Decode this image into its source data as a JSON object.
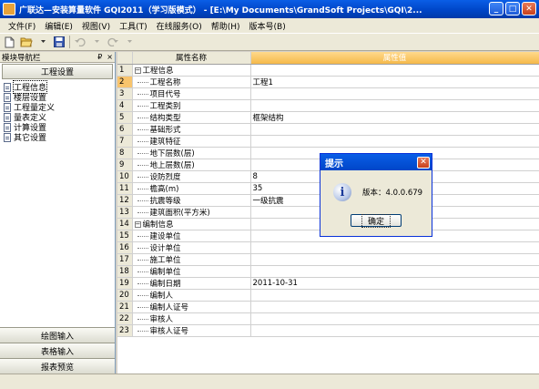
{
  "window": {
    "title": "广联达—安装算量软件 GQI2011（学习版模式） - [E:\\My Documents\\GrandSoft Projects\\GQI\\2...",
    "minimize": "_",
    "maximize": "□",
    "close": "✕"
  },
  "menu": [
    "文件(F)",
    "编辑(E)",
    "视图(V)",
    "工具(T)",
    "在线服务(O)",
    "帮助(H)",
    "版本号(B)"
  ],
  "toolbar": {
    "icons": [
      "new-file-icon",
      "open-folder-icon",
      "save-icon",
      "undo-icon",
      "redo-icon"
    ]
  },
  "nav": {
    "header": "模块导航栏",
    "pin": "₽",
    "close": "×",
    "top_tab": "工程设置",
    "items": [
      {
        "label": "工程信息"
      },
      {
        "label": "楼层设置"
      },
      {
        "label": "工程量定义"
      },
      {
        "label": "量表定义"
      },
      {
        "label": "计算设置"
      },
      {
        "label": "其它设置"
      }
    ],
    "bottom_tabs": [
      "绘图输入",
      "表格输入",
      "报表预览"
    ]
  },
  "grid": {
    "headers": {
      "name": "属性名称",
      "value": "属性值"
    },
    "rows": [
      {
        "num": "1",
        "name": "工程信息",
        "value": "",
        "group": true
      },
      {
        "num": "2",
        "name": "工程名称",
        "value": "工程1"
      },
      {
        "num": "3",
        "name": "项目代号",
        "value": ""
      },
      {
        "num": "4",
        "name": "工程类别",
        "value": ""
      },
      {
        "num": "5",
        "name": "结构类型",
        "value": "框架结构"
      },
      {
        "num": "6",
        "name": "基础形式",
        "value": ""
      },
      {
        "num": "7",
        "name": "建筑特征",
        "value": ""
      },
      {
        "num": "8",
        "name": "地下层数(层)",
        "value": ""
      },
      {
        "num": "9",
        "name": "地上层数(层)",
        "value": ""
      },
      {
        "num": "10",
        "name": "设防烈度",
        "value": "8"
      },
      {
        "num": "11",
        "name": "檐高(m)",
        "value": "35"
      },
      {
        "num": "12",
        "name": "抗震等级",
        "value": "一级抗震"
      },
      {
        "num": "13",
        "name": "建筑面积(平方米)",
        "value": ""
      },
      {
        "num": "14",
        "name": "编制信息",
        "value": "",
        "group": true
      },
      {
        "num": "15",
        "name": "建设单位",
        "value": ""
      },
      {
        "num": "16",
        "name": "设计单位",
        "value": ""
      },
      {
        "num": "17",
        "name": "施工单位",
        "value": ""
      },
      {
        "num": "18",
        "name": "编制单位",
        "value": ""
      },
      {
        "num": "19",
        "name": "编制日期",
        "value": "2011-10-31"
      },
      {
        "num": "20",
        "name": "编制人",
        "value": ""
      },
      {
        "num": "21",
        "name": "编制人证号",
        "value": ""
      },
      {
        "num": "22",
        "name": "审核人",
        "value": ""
      },
      {
        "num": "23",
        "name": "审核人证号",
        "value": ""
      }
    ]
  },
  "dialog": {
    "title": "提示",
    "message": "版本：4.0.0.679",
    "ok": "确定",
    "close": "✕"
  },
  "colors": {
    "title_bar": "#0a5ee6",
    "value_header": "#f5b94a",
    "active_row": "#f8c46c"
  }
}
